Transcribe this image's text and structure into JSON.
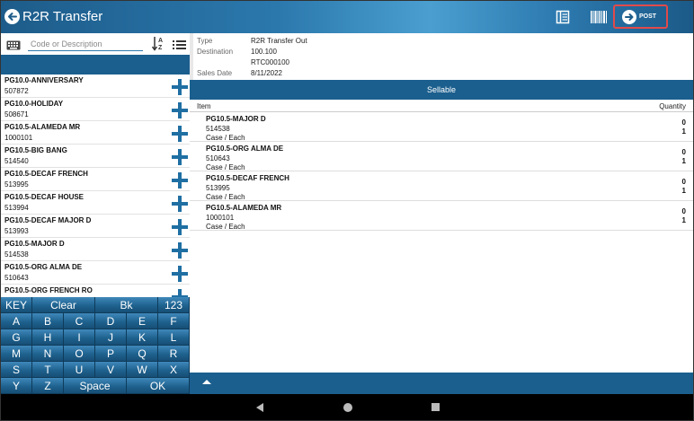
{
  "app": {
    "title": "R2R Transfer"
  },
  "toolbar": {
    "post_label": "POST"
  },
  "search": {
    "placeholder": "Code or Description",
    "value": ""
  },
  "product_list": [
    {
      "name": "PG10.0-ANNIVERSARY",
      "code": "507872"
    },
    {
      "name": "PG10.0-HOLIDAY",
      "code": "508671"
    },
    {
      "name": "PG10.5-ALAMEDA MR",
      "code": "1000101"
    },
    {
      "name": "PG10.5-BIG BANG",
      "code": "514540"
    },
    {
      "name": "PG10.5-DECAF FRENCH",
      "code": "513995"
    },
    {
      "name": "PG10.5-DECAF HOUSE",
      "code": "513994"
    },
    {
      "name": "PG10.5-DECAF MAJOR D",
      "code": "513993"
    },
    {
      "name": "PG10.5-MAJOR D",
      "code": "514538"
    },
    {
      "name": "PG10.5-ORG  ALMA DE",
      "code": "510643"
    },
    {
      "name": "PG10.5-ORG FRENCH RO",
      "code": ""
    }
  ],
  "keyboard": {
    "rows": [
      [
        "KEY",
        "Clear",
        "Bk",
        "123"
      ],
      [
        "A",
        "B",
        "C",
        "D",
        "E",
        "F"
      ],
      [
        "G",
        "H",
        "I",
        "J",
        "K",
        "L"
      ],
      [
        "M",
        "N",
        "O",
        "P",
        "Q",
        "R"
      ],
      [
        "S",
        "T",
        "U",
        "V",
        "W",
        "X"
      ],
      [
        "Y",
        "Z",
        "Space",
        "OK"
      ]
    ]
  },
  "details": {
    "type_label": "Type",
    "type_value": "R2R Transfer Out",
    "destination_label": "Destination",
    "destination_value": "100.100",
    "destination_ref": "RTC000100",
    "sales_date_label": "Sales Date",
    "sales_date_value": "8/11/2022"
  },
  "section_title": "Sellable",
  "columns": {
    "item": "Item",
    "quantity": "Quantity"
  },
  "transfer_items": [
    {
      "name": "PG10.5-MAJOR D",
      "code": "514538",
      "unit": "Case / Each",
      "qty_case": "0",
      "qty_each": "1"
    },
    {
      "name": "PG10.5-ORG  ALMA DE",
      "code": "510643",
      "unit": "Case / Each",
      "qty_case": "0",
      "qty_each": "1"
    },
    {
      "name": "PG10.5-DECAF FRENCH",
      "code": "513995",
      "unit": "Case / Each",
      "qty_case": "0",
      "qty_each": "1"
    },
    {
      "name": "PG10.5-ALAMEDA MR",
      "code": "1000101",
      "unit": "Case / Each",
      "qty_case": "0",
      "qty_each": "1"
    }
  ],
  "colors": {
    "primary": "#1b5f8e",
    "accent": "#2b78ad",
    "post_highlight": "#e24a4a"
  }
}
